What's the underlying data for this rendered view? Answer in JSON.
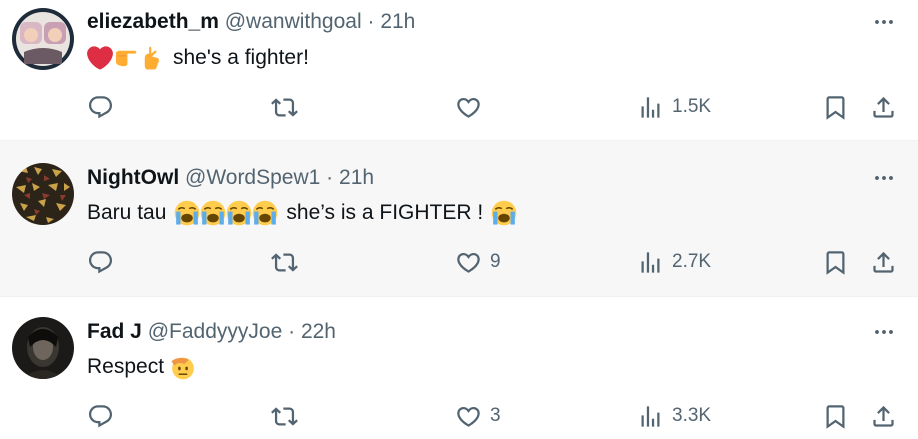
{
  "tweets": [
    {
      "name": "eliezabeth_m",
      "handle": "@wanwithgoal",
      "dot": "·",
      "time": "21h",
      "text": "she's a fighter!",
      "emojis": [
        "red-heart",
        "backhand-index-pointing-right",
        "hand-with-index-finger-and-thumb-crossed"
      ],
      "replies": "",
      "reposts": "",
      "likes": "",
      "views": "1.5K",
      "highlighted": false
    },
    {
      "name": "NightOwl",
      "handle": "@WordSpew1",
      "dot": "·",
      "time": "21h",
      "text_before": "Baru tau",
      "text_after": "she’s is a FIGHTER !",
      "emojis": [
        "loudly-crying-face",
        "loudly-crying-face",
        "loudly-crying-face",
        "loudly-crying-face",
        "loudly-crying-face"
      ],
      "replies": "",
      "reposts": "",
      "likes": "9",
      "views": "2.7K",
      "highlighted": true
    },
    {
      "name": "Fad J",
      "handle": "@FaddyyyJoe",
      "dot": "·",
      "time": "22h",
      "text": "Respect",
      "emojis": [
        "saluting-face"
      ],
      "replies": "",
      "reposts": "",
      "likes": "3",
      "views": "3.3K",
      "highlighted": false
    }
  ],
  "icons": {
    "reply": "reply-icon",
    "repost": "repost-icon",
    "like": "like-icon",
    "views": "views-icon",
    "bookmark": "bookmark-icon",
    "share": "share-icon",
    "more": "more-icon"
  },
  "colors": {
    "text": "#0f1419",
    "secondary": "#536471",
    "highlight_bg": "#f7f7f7",
    "divider": "#eff3f4"
  }
}
